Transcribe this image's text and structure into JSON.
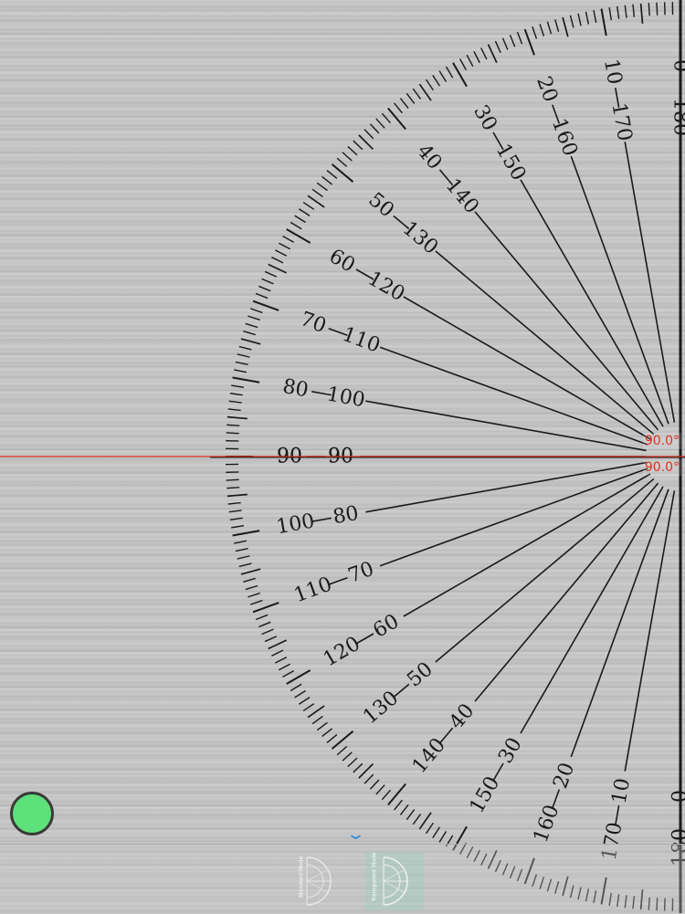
{
  "protractor": {
    "readings": [
      "90.0°",
      "90.0°"
    ],
    "labels_outer_top": [
      "0",
      "10",
      "20",
      "30",
      "40",
      "50",
      "60",
      "70",
      "80",
      "90"
    ],
    "labels_inner_top": [
      "180",
      "170",
      "160",
      "150",
      "140",
      "130",
      "120",
      "110",
      "100",
      "90"
    ],
    "labels_outer_bottom": [
      "90",
      "100",
      "110",
      "120",
      "130",
      "140",
      "150",
      "160",
      "170",
      "180"
    ],
    "labels_inner_bottom": [
      "90",
      "80",
      "70",
      "60",
      "50",
      "40",
      "30",
      "20",
      "10",
      "0"
    ],
    "line_color": "#d9301e",
    "ink_color": "#1a1a1a"
  },
  "modes": [
    {
      "label": "Standard Mode",
      "active": false
    },
    {
      "label": "Transparent Mode",
      "active": true
    }
  ],
  "colors": {
    "record_button": "#5ee07a",
    "chevron": "#2b8ad8"
  },
  "icons": {
    "chevron": "chevron-down-icon",
    "record": "record-button"
  }
}
